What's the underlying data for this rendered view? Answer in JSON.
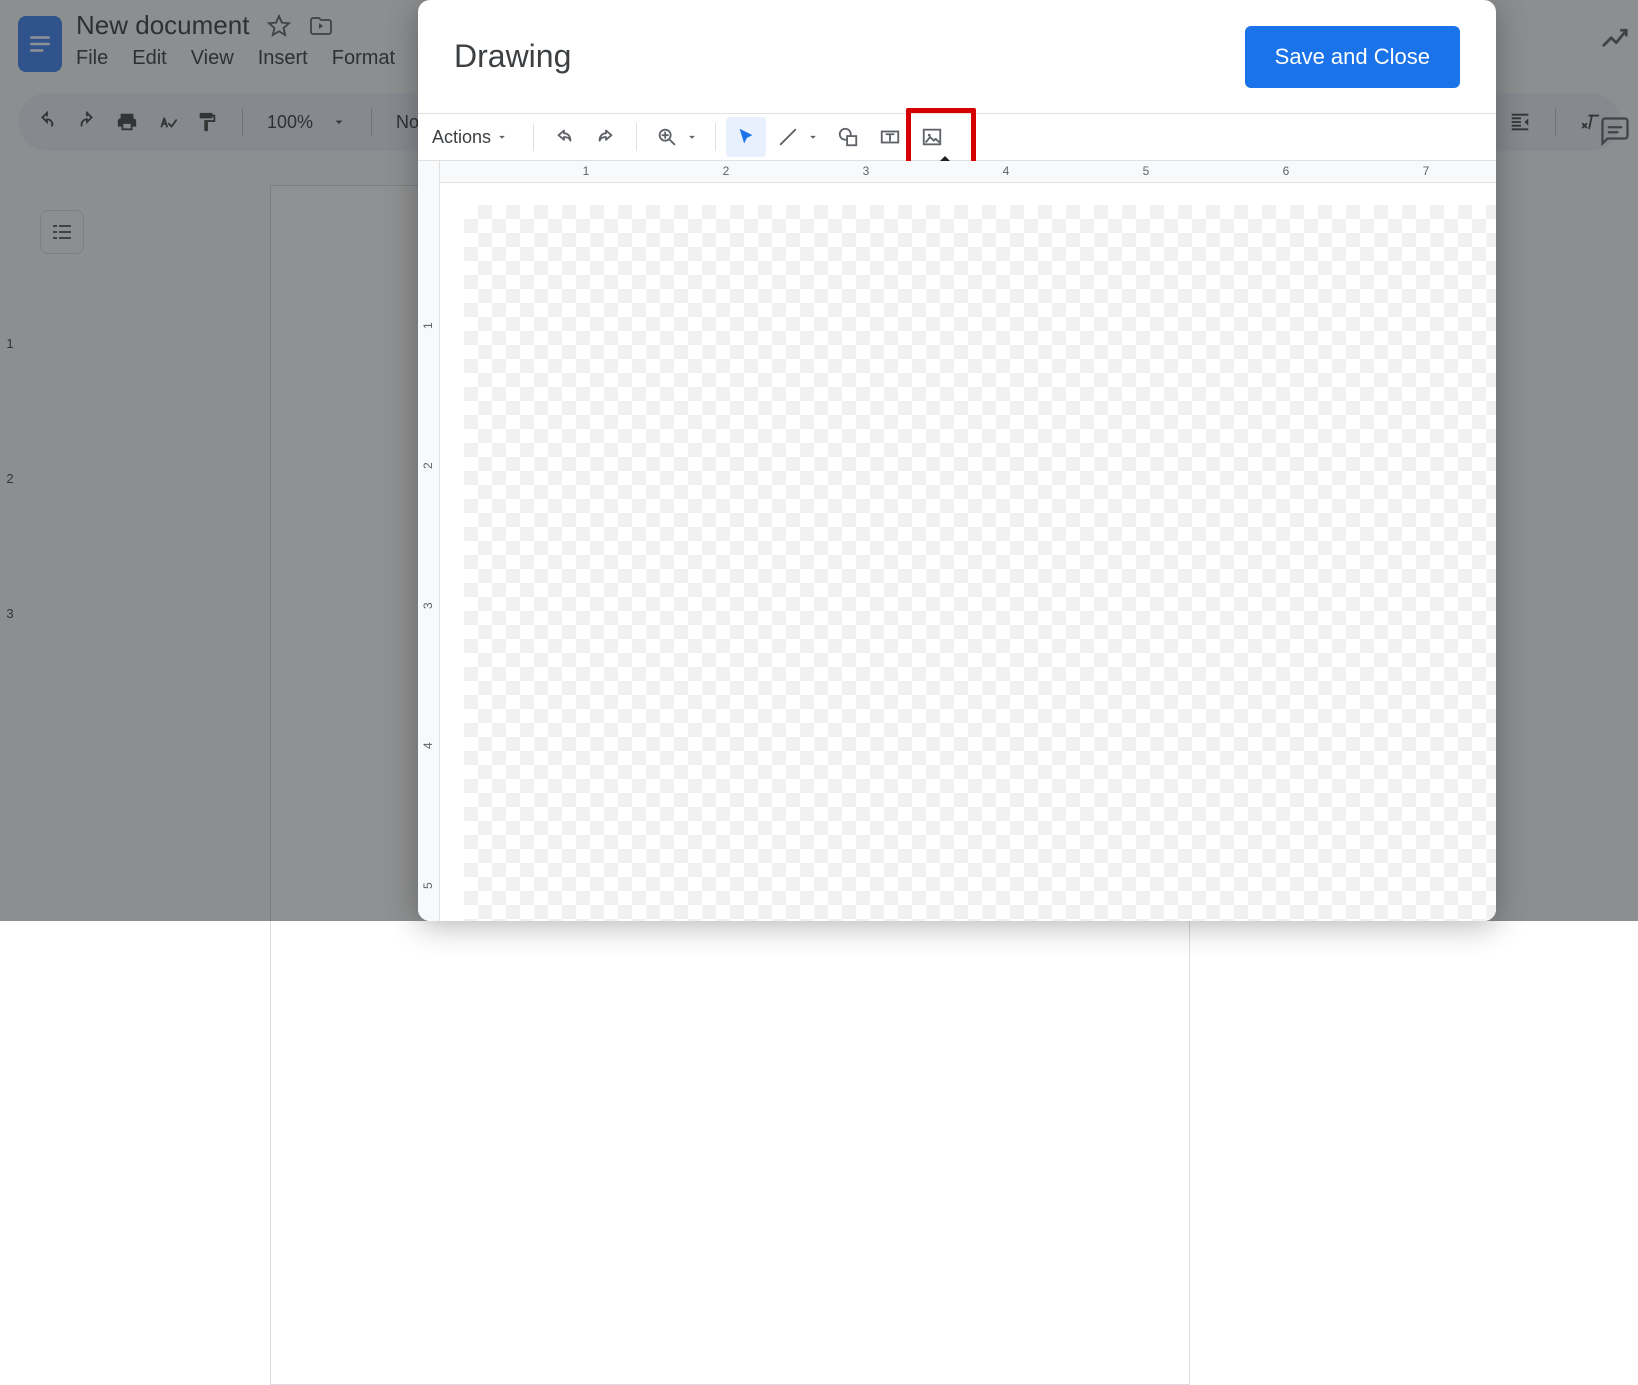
{
  "docs": {
    "title": "New document",
    "menubar": [
      "File",
      "Edit",
      "View",
      "Insert",
      "Format"
    ],
    "zoom": "100%",
    "style": "Normal",
    "left_ruler": [
      "1",
      "2",
      "3"
    ]
  },
  "dialog": {
    "title": "Drawing",
    "save_label": "Save and Close",
    "actions_label": "Actions",
    "tooltip": {
      "image": "Image"
    },
    "h_ruler": [
      "1",
      "2",
      "3",
      "4",
      "5",
      "6",
      "7"
    ],
    "v_ruler": [
      "1",
      "2",
      "3",
      "4",
      "5"
    ]
  }
}
